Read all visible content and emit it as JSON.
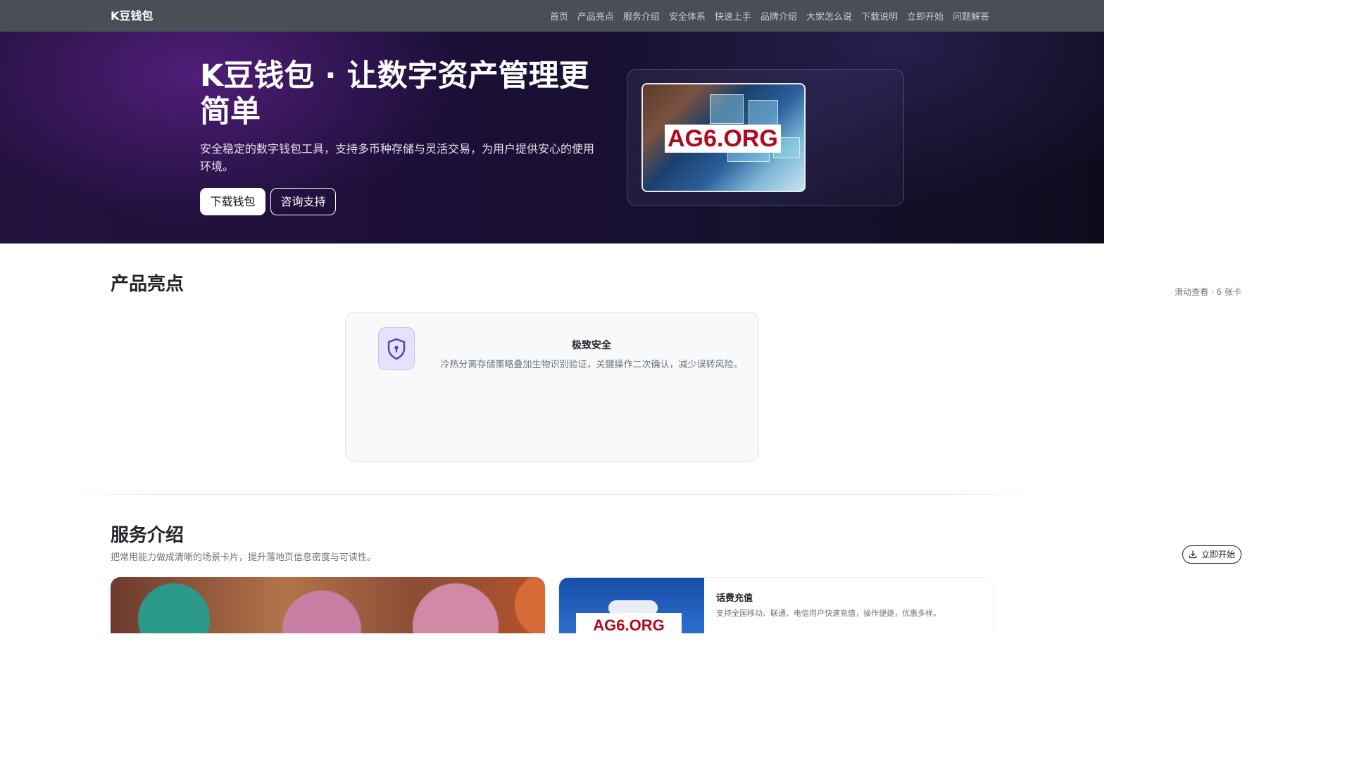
{
  "nav": {
    "brand": "K豆钱包",
    "links": [
      "首页",
      "产品亮点",
      "服务介绍",
      "安全体系",
      "快速上手",
      "品牌介绍",
      "大家怎么说",
      "下载说明",
      "立即开始",
      "问题解答"
    ]
  },
  "hero": {
    "title": "K豆钱包 · 让数字资产管理更简单",
    "subtitle": "安全稳定的数字钱包工具，支持多币种存储与灵活交易，为用户提供安心的使用环境。",
    "primary_btn": "下载钱包",
    "secondary_btn": "咨询支持",
    "image_watermark": "AG6.ORG"
  },
  "highlights": {
    "title": "产品亮点",
    "hint": "滑动查看 · 6 张卡",
    "card": {
      "icon": "shield-lock-icon",
      "title": "极致安全",
      "desc": "冷热分离存储策略叠加生物识别验证，关键操作二次确认，减少误转风险。"
    }
  },
  "services": {
    "title": "服务介绍",
    "subtitle": "把常用能力做成清晰的场景卡片，提升落地页信息密度与可读性。",
    "start_btn": "立即开始",
    "card2": {
      "title": "话费充值",
      "desc": "支持全国移动、联通、电信用户快速充值，操作便捷，优惠多样。",
      "image_watermark": "AG6.ORG"
    }
  },
  "colors": {
    "navbar": "#4a4f57",
    "hero_bg": "#1c0f38",
    "accent_icon": "#5a4bd1",
    "watermark": "#b1091b"
  }
}
